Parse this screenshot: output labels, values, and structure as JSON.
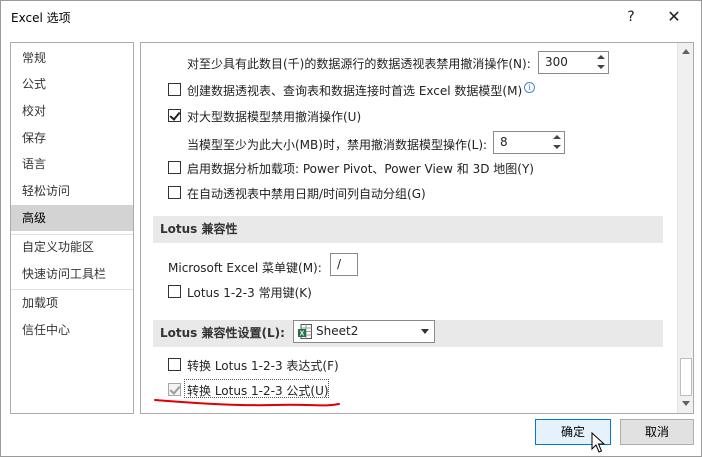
{
  "window": {
    "title": "Excel 选项",
    "help_label": "?",
    "close_label": "✕"
  },
  "nav": {
    "items": [
      {
        "label": "常规"
      },
      {
        "label": "公式"
      },
      {
        "label": "校对"
      },
      {
        "label": "保存"
      },
      {
        "label": "语言"
      },
      {
        "label": "轻松访问"
      },
      {
        "label": "高级",
        "active": true
      },
      {
        "label": "自定义功能区"
      },
      {
        "label": "快速访问工具栏"
      },
      {
        "label": "加载项"
      },
      {
        "label": "信任中心"
      }
    ]
  },
  "options": {
    "undo_rows_label": "对至少具有此数目(千)的数据源行的数据透视表禁用撤消操作(N):",
    "undo_rows_value": "300",
    "create_model_label": "创建数据透视表、查询表和数据连接时首选 Excel 数据模型(M)",
    "create_model_checked": false,
    "disable_undo_large_label": "对大型数据模型禁用撤消操作(U)",
    "disable_undo_large_checked": true,
    "model_size_label": "当模型至少为此大小(MB)时，禁用撤消数据模型操作(L):",
    "model_size_value": "8",
    "enable_addins_label": "启用数据分析加载项: Power Pivot、Power View 和 3D 地图(Y)",
    "enable_addins_checked": false,
    "disable_autogroup_label": "在自动透视表中禁用日期/时间列自动分组(G)",
    "disable_autogroup_checked": false
  },
  "lotus_compat": {
    "section_title": "Lotus 兼容性",
    "menu_key_label": "Microsoft Excel 菜单键(M):",
    "menu_key_value": "/",
    "nav_keys_label": "Lotus 1-2-3 常用键(K)",
    "nav_keys_checked": false
  },
  "lotus_settings": {
    "section_title": "Lotus 兼容性设置(L):",
    "sheet_value": "Sheet2",
    "transition_expr_label": "转换 Lotus 1-2-3 表达式(F)",
    "transition_expr_checked": false,
    "transition_formula_label": "转换 Lotus 1-2-3 公式(U)",
    "transition_formula_checked": true
  },
  "footer": {
    "ok_label": "确定",
    "cancel_label": "取消"
  },
  "colors": {
    "accent": "#0078d7",
    "annotation_red": "#e00000",
    "excel_green": "#217346"
  }
}
